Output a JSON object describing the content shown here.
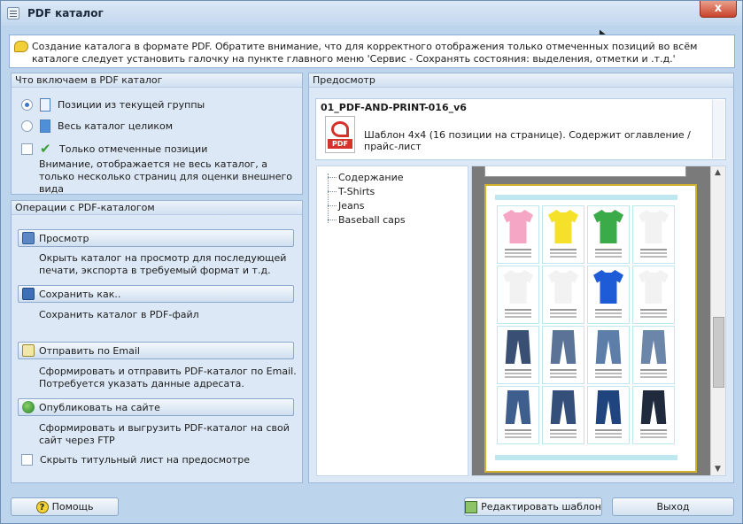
{
  "window": {
    "title": "PDF  каталог",
    "close_label": "x"
  },
  "info": {
    "text": "Создание каталога в формате PDF. Обратите внимание, что для корректного отображения только отмеченных позиций во всём каталоге следует установить галочку на пункте главного меню 'Сервис - Сохранять состояния: выделения, отметки и .т.д.'"
  },
  "include": {
    "header": "Что включаем в PDF каталог",
    "opt_group": "Позиции из текущей группы",
    "opt_all": "Весь каталог целиком",
    "opt_marked": "Только отмеченные позиции",
    "note": "Внимание, отображается не весь каталог, а только несколько страниц для оценки внешнего вида"
  },
  "ops": {
    "header": "Операции с PDF-каталогом",
    "view_label": "Просмотр",
    "view_desc": "Окрыть каталог на просмотр для последующей печати, экспорта в требуемый формат и т.д.",
    "save_label": "Сохранить как..",
    "save_desc": "Сохранить каталог в PDF-файл",
    "email_label": "Отправить по Email",
    "email_desc": "Сформировать и отправить PDF-каталог по Email. Потребуется указать данные адресата.",
    "publish_label": "Опубликовать на сайте",
    "publish_desc": "Сформировать и выгрузить PDF-каталог на свой сайт через FTP",
    "hide_title": "Скрыть титульный лист на предосмотре"
  },
  "preview": {
    "header": "Предосмотр",
    "template_name": "01_PDF-AND-PRINT-016_v6",
    "pdf_tag": "PDF",
    "template_desc": "Шаблон 4x4 (16 позиции на странице). Содержит оглавление / прайс-лист",
    "tree": [
      "Содержание",
      "T-Shirts",
      "Jeans",
      "Baseball caps"
    ]
  },
  "buttons": {
    "help": "Помощь",
    "edit_template": "Редактировать шаблон",
    "exit": "Выход"
  },
  "colors": {
    "tees": [
      "#f4a6c4",
      "#f5e02a",
      "#3bab4a",
      "#ffffff",
      "#ffffff",
      "#ffffff",
      "#1e5bd6",
      "#ffffff"
    ],
    "jeans": [
      "#3a4f74",
      "#5a7397",
      "#5d7ea8",
      "#6b86a8",
      "#3e5e8e",
      "#34507a",
      "#20447e",
      "#1f2a3d"
    ]
  }
}
